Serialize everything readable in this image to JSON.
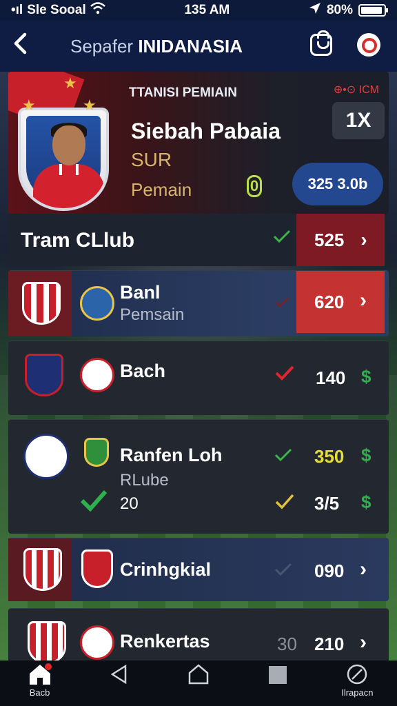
{
  "status_bar": {
    "carrier": "Sle Sooal",
    "time": "135 AM",
    "battery": "80%"
  },
  "header": {
    "title_prefix": "Sepafer",
    "title_main": "INIDANASIA"
  },
  "player": {
    "section_label": "TTANISI PEMIAIN",
    "brand": "⊕•⊙ ICM",
    "name": "Siebah Pabaia",
    "club": "SUR",
    "role": "Pemain",
    "indicator": "0",
    "multiplier": "1X",
    "value": "325 3.0b"
  },
  "team": {
    "title": "Tram CLlub",
    "value": "525"
  },
  "rows": [
    {
      "title": "Banl",
      "subtitle": "Pemsain",
      "value": "620"
    },
    {
      "title": "Bach",
      "value": "140"
    },
    {
      "title": "Ranfen Loh",
      "subtitle": "RLube",
      "value": "350",
      "secondary_count": "20",
      "secondary_value": "3/5"
    },
    {
      "title": "Crinhgkial",
      "value": "090"
    },
    {
      "title": "Renkertas",
      "extra": "30",
      "value": "210"
    }
  ],
  "nav": {
    "home_label": "Bacb",
    "last_label": "Ilrapacn"
  },
  "colors": {
    "header_bg": "#0f1d45",
    "accent_red": "#c8202b",
    "accent_blue": "#24488f",
    "check_green": "#2fb04c",
    "check_yellow": "#e6c23a"
  }
}
